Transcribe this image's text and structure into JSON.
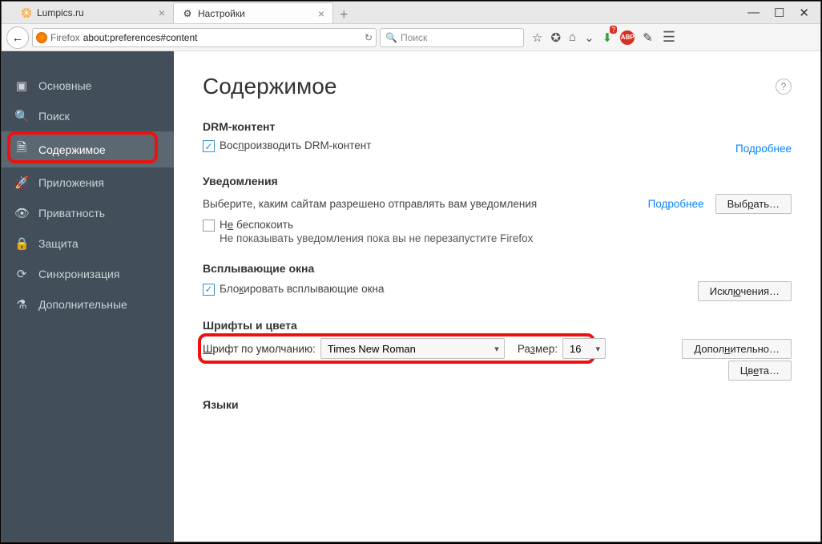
{
  "tabs": [
    {
      "label": "Lumpics.ru",
      "active": false
    },
    {
      "label": "Настройки",
      "active": true
    }
  ],
  "toolbar": {
    "brand": "Firefox",
    "url": "about:preferences#content",
    "search_placeholder": "Поиск"
  },
  "sidebar": {
    "items": [
      {
        "label": "Основные"
      },
      {
        "label": "Поиск"
      },
      {
        "label": "Содержимое"
      },
      {
        "label": "Приложения"
      },
      {
        "label": "Приватность"
      },
      {
        "label": "Защита"
      },
      {
        "label": "Синхронизация"
      },
      {
        "label": "Дополнительные"
      }
    ]
  },
  "page": {
    "title": "Содержимое",
    "drm": {
      "heading": "DRM-контент",
      "checkbox": "Воспроизводить DRM-контент",
      "more": "Подробнее"
    },
    "notif": {
      "heading": "Уведомления",
      "desc": "Выберите, каким сайтам разрешено отправлять вам уведомления",
      "more": "Подробнее",
      "choose_btn": "Выбрать…",
      "dnd": "Не беспокоить",
      "dnd_note": "Не показывать уведомления пока вы не перезапустите Firefox"
    },
    "popups": {
      "heading": "Всплывающие окна",
      "checkbox": "Блокировать всплывающие окна",
      "exceptions_btn": "Исключения…"
    },
    "fonts": {
      "heading": "Шрифты и цвета",
      "default_label": "Шрифт по умолчанию:",
      "font_value": "Times New Roman",
      "size_label": "Размер:",
      "size_value": "16",
      "advanced_btn": "Дополнительно…",
      "colors_btn": "Цвета…"
    },
    "langs": {
      "heading": "Языки"
    }
  }
}
